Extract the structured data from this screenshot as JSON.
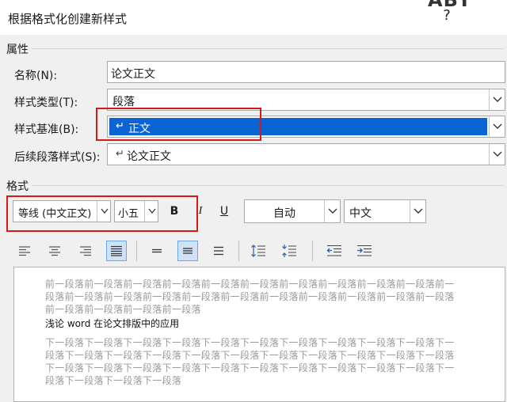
{
  "window": {
    "title": "根据格式化创建新样式",
    "help_label": "?",
    "top_glyph": "ABY"
  },
  "properties": {
    "section_label": "属性",
    "name": {
      "label": "名称(N):",
      "value": "论文正文"
    },
    "style_type": {
      "label": "样式类型(T):",
      "value": "段落"
    },
    "style_base": {
      "label": "样式基准(B):",
      "value": "正文",
      "marker": "↵"
    },
    "following_style": {
      "label": "后续段落样式(S):",
      "value": "论文正文",
      "marker": "↵"
    }
  },
  "format": {
    "section_label": "格式",
    "font_name": "等线 (中文正文)",
    "font_size": "小五",
    "bold_label": "B",
    "italic_label": "I",
    "underline_label": "U",
    "color": "自动",
    "script": "中文"
  },
  "preview": {
    "before_lines": [
      "前一段落前一段落前一段落前一段落前一段落前一段落前一段落前一段落前一段落前一段落前一",
      "段落前一段落前一段落前一段落前一段落前一段落前一段落前一段落前一段落前一段落前一段落",
      "前一段落前一段落前一段落前一段落"
    ],
    "sample": "浅论 word 在论文排版中的应用",
    "after_lines": [
      "下一段落下一段落下一段落下一段落下一段落下一段落下一段落下一段落下一段落下一段落下一",
      "段落下一段落下一段落下一段落下一段落下一段落下一段落下一段落下一段落下一段落下一段落",
      "下一段落下一段落下一段落下一段落下一段落下一段落下一段落下一段落下一段落下一段落下一",
      "段落下一段落下一段落下一段落"
    ]
  },
  "colors": {
    "highlight": "#0a64d4",
    "annotation_red": "#d51a1a",
    "active_button": "#cfe2f8"
  }
}
